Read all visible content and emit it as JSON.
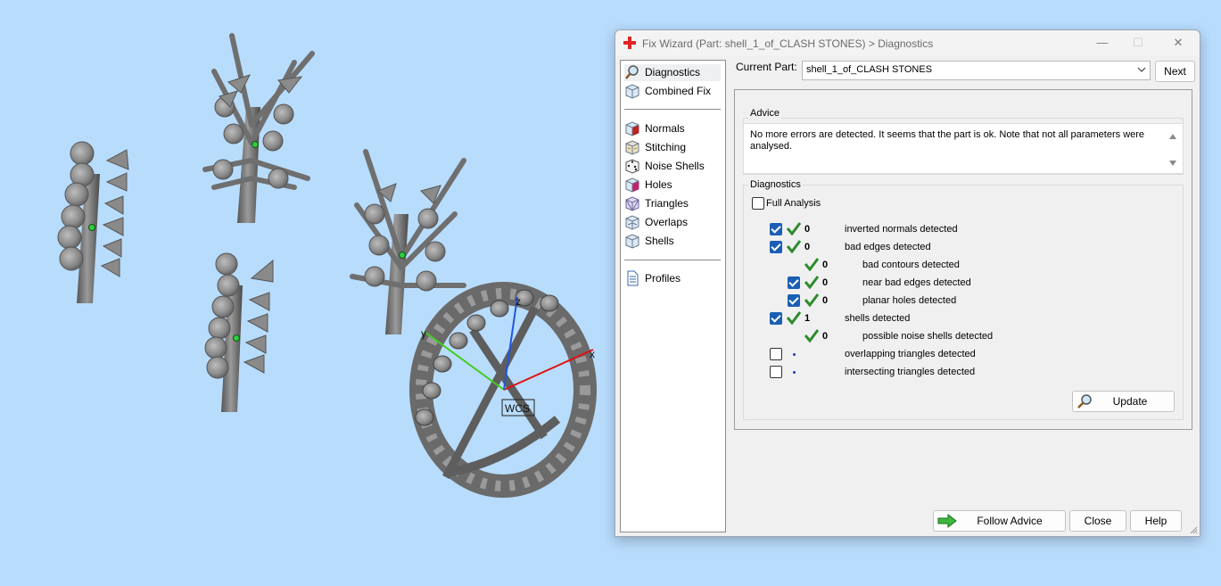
{
  "viewport": {
    "axis_labels": {
      "x": "x",
      "y": "y",
      "z": "z"
    },
    "wcs_label": "WCS"
  },
  "dialog": {
    "title": "Fix Wizard (Part: shell_1_of_CLASH STONES) > Diagnostics",
    "window_controls": {
      "minimize": "—",
      "maximize": "☐",
      "close": "✕"
    },
    "nav": {
      "items": [
        {
          "label": "Diagnostics",
          "icon": "magnifier-icon",
          "selected": true
        },
        {
          "label": "Combined Fix",
          "icon": "cube-icon"
        },
        {
          "label": "Normals",
          "icon": "normals-cube-icon"
        },
        {
          "label": "Stitching",
          "icon": "stitching-cube-icon"
        },
        {
          "label": "Noise Shells",
          "icon": "dice-icon"
        },
        {
          "label": "Holes",
          "icon": "holes-cube-icon"
        },
        {
          "label": "Triangles",
          "icon": "triangles-cube-icon"
        },
        {
          "label": "Overlaps",
          "icon": "overlaps-cube-icon"
        },
        {
          "label": "Shells",
          "icon": "shells-cube-icon"
        },
        {
          "label": "Profiles",
          "icon": "document-icon"
        }
      ]
    },
    "current_part": {
      "label": "Current Part:",
      "value": "shell_1_of_CLASH STONES"
    },
    "next_label": "Next",
    "advice": {
      "title": "Advice",
      "text": "No more errors are detected. It seems that the part is ok. Note that not all parameters were analysed."
    },
    "diagnostics": {
      "title": "Diagnostics",
      "full_analysis": {
        "label": "Full Analysis",
        "checked": false
      },
      "rows": [
        {
          "checked": true,
          "check": true,
          "count": "0",
          "label": "inverted normals detected"
        },
        {
          "checked": true,
          "check": true,
          "count": "0",
          "label": "bad edges detected"
        },
        {
          "checked": null,
          "check": true,
          "count": "0",
          "label": "bad contours detected"
        },
        {
          "checked": true,
          "check": true,
          "count": "0",
          "label": "near bad edges detected"
        },
        {
          "checked": true,
          "check": true,
          "count": "0",
          "label": "planar holes detected"
        },
        {
          "checked": true,
          "check": true,
          "count": "1",
          "label": "shells detected"
        },
        {
          "checked": null,
          "check": true,
          "count": "0",
          "label": "possible noise shells detected"
        },
        {
          "checked": false,
          "check": false,
          "count": "",
          "label": "overlapping triangles detected"
        },
        {
          "checked": false,
          "check": false,
          "count": "",
          "label": "intersecting triangles detected"
        }
      ],
      "update_label": "Update"
    },
    "footer": {
      "follow_advice_label": "Follow Advice",
      "close_label": "Close",
      "help_label": "Help"
    },
    "colors": {
      "check_green": "#2e8b2e",
      "checkbox_blue": "#1a5fb4"
    }
  }
}
